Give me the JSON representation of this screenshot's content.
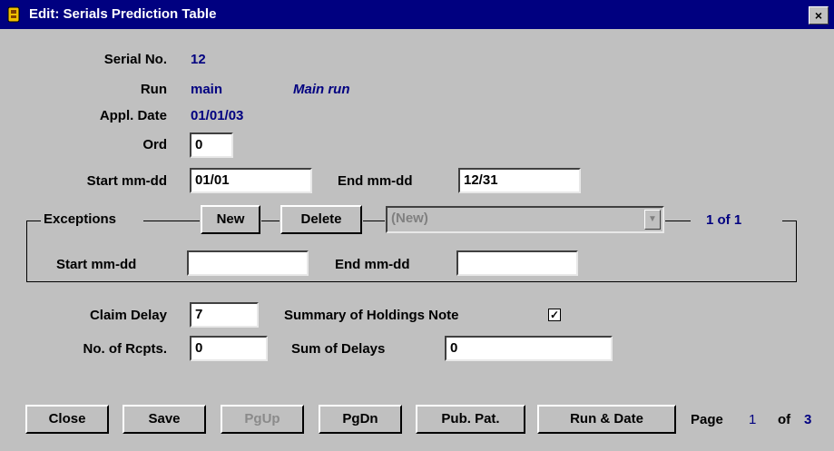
{
  "window": {
    "title": "Edit: Serials Prediction Table",
    "close_label": "×"
  },
  "fields": {
    "serial_no_label": "Serial No.",
    "serial_no": "12",
    "run_label": "Run",
    "run": "main",
    "run_desc": "Main run",
    "appl_date_label": "Appl. Date",
    "appl_date": "01/01/03",
    "ord_label": "Ord",
    "ord": "0",
    "start_label": "Start mm-dd",
    "start": "01/01",
    "end_label": "End mm-dd",
    "end": "12/31"
  },
  "exceptions": {
    "label": "Exceptions",
    "new_button": "New",
    "delete_button": "Delete",
    "selected": "(New)",
    "position": "1 of 1",
    "start_label": "Start mm-dd",
    "start": "",
    "end_label": "End mm-dd",
    "end": ""
  },
  "claim": {
    "claim_delay_label": "Claim Delay",
    "claim_delay": "7",
    "summary_label": "Summary of Holdings Note",
    "summary_checked": true,
    "rcpts_label": "No. of Rcpts.",
    "rcpts": "0",
    "sum_delays_label": "Sum of Delays",
    "sum_delays": "0"
  },
  "buttons": {
    "close": "Close",
    "save": "Save",
    "pgup": "PgUp",
    "pgdn": "PgDn",
    "pub_pat": "Pub. Pat.",
    "run_date": "Run & Date"
  },
  "paging": {
    "page_label": "Page",
    "current": "1",
    "of_label": "of",
    "total": "3"
  },
  "colors": {
    "title_bar": "#000080",
    "value_text": "#000080",
    "background": "#c0c0c0"
  }
}
